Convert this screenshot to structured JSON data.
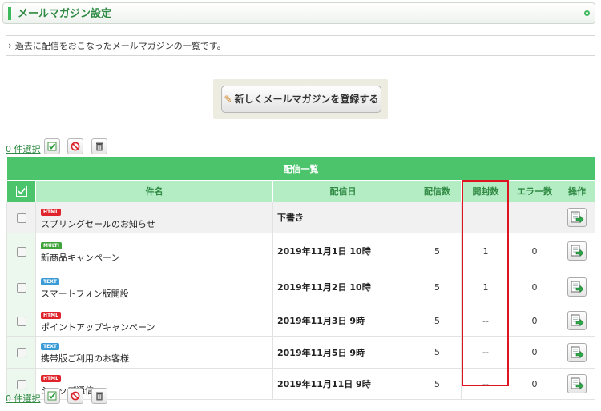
{
  "header": {
    "title": "メールマガジン設定"
  },
  "description": "過去に配信をおこなったメールマガジンの一覧です。",
  "new_button": {
    "label": "新しくメールマガジンを登録する"
  },
  "selection": {
    "count_label": "0 件選択"
  },
  "table": {
    "title": "配信一覧",
    "columns": [
      "件名",
      "配信日",
      "配信数",
      "開封数",
      "エラー数",
      "操作"
    ],
    "rows": [
      {
        "badge": "HTML",
        "badge_color": "#e0242b",
        "subject": "スプリングセールのお知らせ",
        "date": "下書き",
        "sent": "",
        "opened": "",
        "errors": ""
      },
      {
        "badge": "MULTI",
        "badge_color": "#3fa33a",
        "subject": "新商品キャンペーン",
        "date": "2019年11月1日 10時",
        "sent": "5",
        "opened": "1",
        "errors": "0"
      },
      {
        "badge": "TEXT",
        "badge_color": "#3b9bd6",
        "subject": "スマートフォン版開設",
        "date": "2019年11月2日 10時",
        "sent": "5",
        "opened": "1",
        "errors": "0"
      },
      {
        "badge": "HTML",
        "badge_color": "#e0242b",
        "subject": "ポイントアップキャンペーン",
        "date": "2019年11月3日 9時",
        "sent": "5",
        "opened": "--",
        "errors": "0"
      },
      {
        "badge": "TEXT",
        "badge_color": "#3b9bd6",
        "subject": "携帯版ご利用のお客様",
        "date": "2019年11月5日 9時",
        "sent": "5",
        "opened": "--",
        "errors": "0"
      },
      {
        "badge": "HTML",
        "badge_color": "#e0242b",
        "subject": "ショップ通信",
        "date": "2019年11月11日 9時",
        "sent": "5",
        "opened": "--",
        "errors": "0"
      }
    ]
  },
  "colors": {
    "brand_green": "#3cb95a",
    "header_row": "#4cc46c",
    "column_header": "#b4ecc4",
    "highlight": "#e0141e"
  },
  "icons": {
    "select_all": "check-icon",
    "stop": "stop-icon",
    "delete": "trash-icon",
    "operation": "edit-arrow-icon"
  }
}
